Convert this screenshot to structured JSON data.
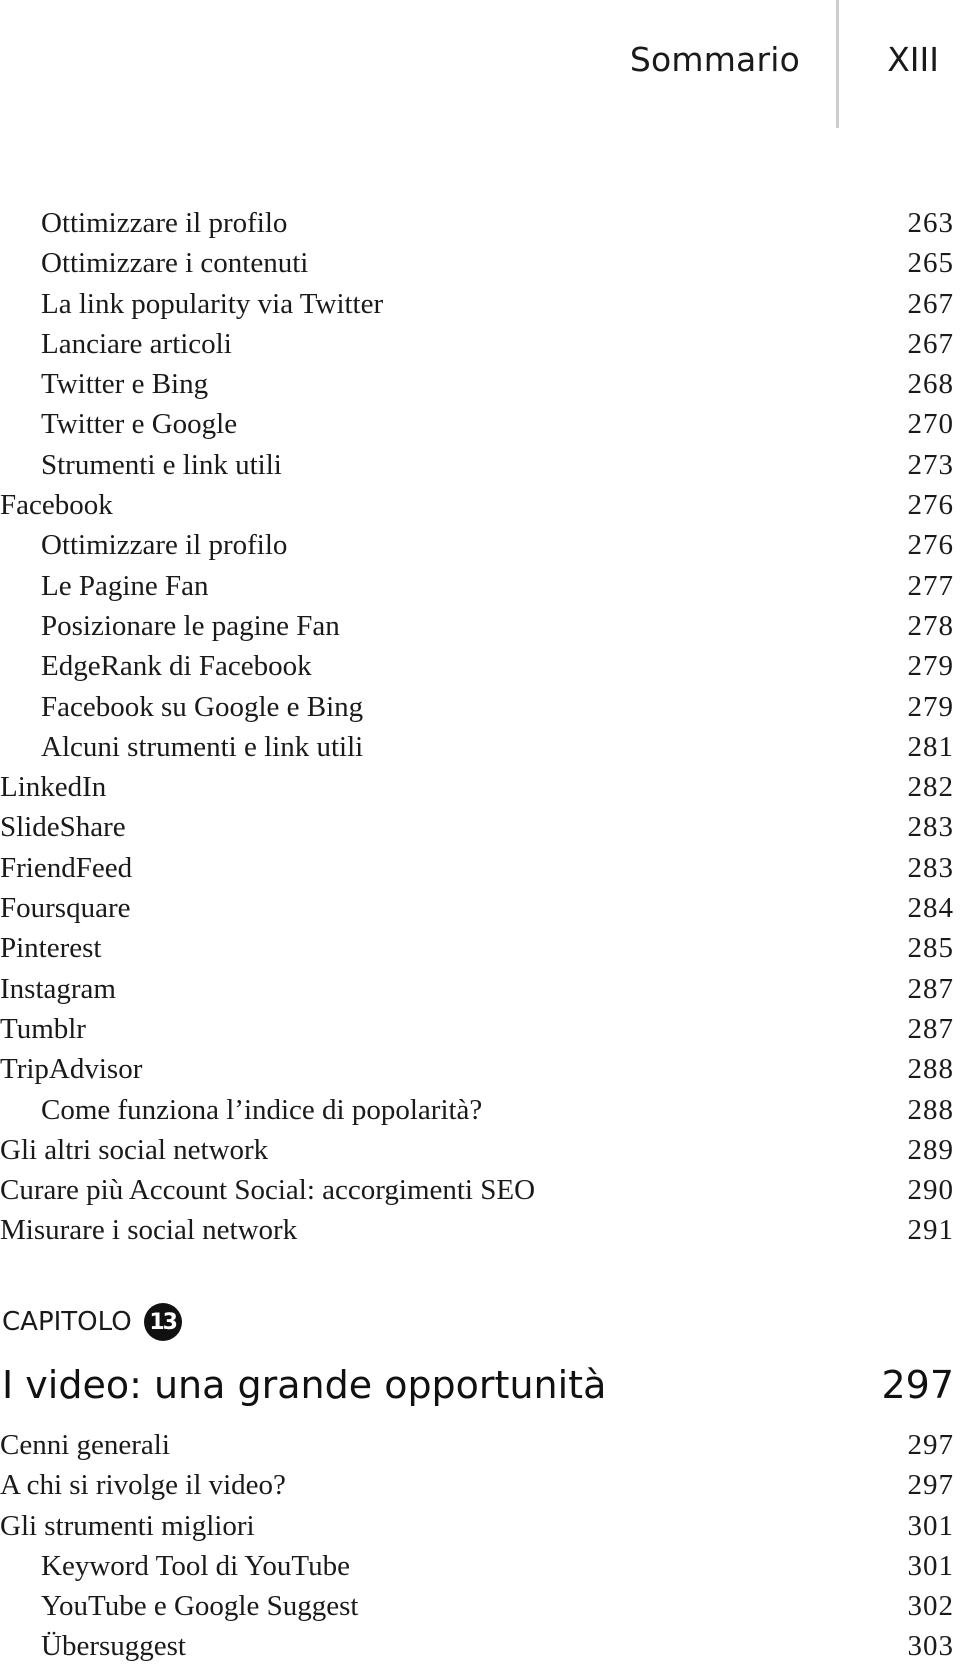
{
  "header": {
    "section_title": "Sommario",
    "page_number": "XIII"
  },
  "toc_continued": [
    {
      "label": "Ottimizzare il profilo",
      "page": "263",
      "level": 2
    },
    {
      "label": "Ottimizzare i contenuti",
      "page": "265",
      "level": 2
    },
    {
      "label": "La link popularity via Twitter",
      "page": "267",
      "level": 2
    },
    {
      "label": "Lanciare articoli",
      "page": "267",
      "level": 2
    },
    {
      "label": "Twitter e Bing",
      "page": "268",
      "level": 2
    },
    {
      "label": "Twitter e Google",
      "page": "270",
      "level": 2
    },
    {
      "label": "Strumenti e link utili",
      "page": "273",
      "level": 2
    },
    {
      "label": "Facebook",
      "page": "276",
      "level": 1
    },
    {
      "label": "Ottimizzare il profilo",
      "page": "276",
      "level": 2
    },
    {
      "label": "Le Pagine Fan",
      "page": "277",
      "level": 2
    },
    {
      "label": "Posizionare le pagine Fan",
      "page": "278",
      "level": 2
    },
    {
      "label": "EdgeRank di Facebook",
      "page": "279",
      "level": 2
    },
    {
      "label": "Facebook su Google e Bing",
      "page": "279",
      "level": 2
    },
    {
      "label": "Alcuni strumenti e link utili",
      "page": "281",
      "level": 2
    },
    {
      "label": "LinkedIn",
      "page": "282",
      "level": 1
    },
    {
      "label": "SlideShare",
      "page": "283",
      "level": 1
    },
    {
      "label": "FriendFeed",
      "page": "283",
      "level": 1
    },
    {
      "label": "Foursquare",
      "page": "284",
      "level": 1
    },
    {
      "label": "Pinterest",
      "page": "285",
      "level": 1
    },
    {
      "label": "Instagram",
      "page": "287",
      "level": 1
    },
    {
      "label": "Tumblr",
      "page": "287",
      "level": 1
    },
    {
      "label": "TripAdvisor",
      "page": "288",
      "level": 1
    },
    {
      "label": "Come funziona l’indice di popolarità?",
      "page": "288",
      "level": 2
    },
    {
      "label": "Gli altri social network",
      "page": "289",
      "level": 1
    },
    {
      "label": "Curare più Account Social: accorgimenti SEO",
      "page": "290",
      "level": 1
    },
    {
      "label": "Misurare i social network",
      "page": "291",
      "level": 1
    }
  ],
  "chapter": {
    "kicker": "CAPITOLO",
    "number": "13",
    "title": "I video: una grande opportunità",
    "page": "297",
    "entries": [
      {
        "label": "Cenni generali",
        "page": "297",
        "level": 1
      },
      {
        "label": "A chi si rivolge il video?",
        "page": "297",
        "level": 1
      },
      {
        "label": "Gli strumenti migliori",
        "page": "301",
        "level": 1
      },
      {
        "label": "Keyword Tool di YouTube",
        "page": "301",
        "level": 2
      },
      {
        "label": "YouTube e Google Suggest",
        "page": "302",
        "level": 2
      },
      {
        "label": "Übersuggest",
        "page": "303",
        "level": 2
      }
    ]
  }
}
